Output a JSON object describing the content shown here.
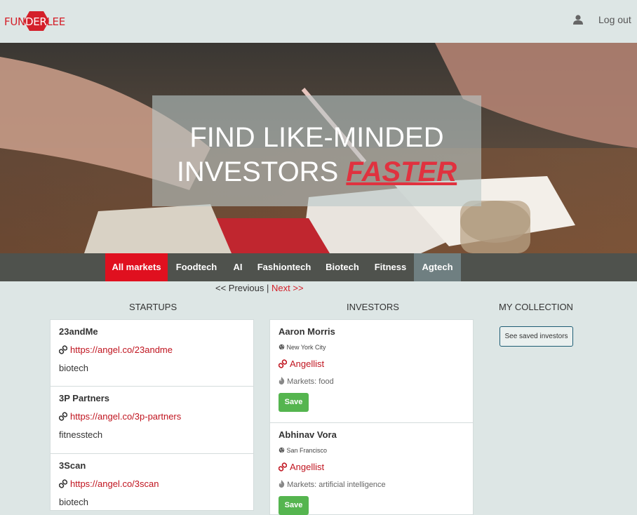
{
  "brand": {
    "logo_left": "FUN",
    "logo_mid": "DER",
    "logo_right": "LEE",
    "accent": "#d4202a"
  },
  "header": {
    "user_icon": "user-icon",
    "logout_label": "Log out"
  },
  "hero": {
    "line1": "FIND LIKE-MINDED",
    "line2_prefix": "INVESTORS",
    "line2_emphasis": "FASTER"
  },
  "nav": {
    "items": [
      {
        "label": "All markets",
        "state": "active"
      },
      {
        "label": "Foodtech",
        "state": "normal"
      },
      {
        "label": "AI",
        "state": "normal"
      },
      {
        "label": "Fashiontech",
        "state": "normal"
      },
      {
        "label": "Biotech",
        "state": "normal"
      },
      {
        "label": "Fitness",
        "state": "normal"
      },
      {
        "label": "Agtech",
        "state": "highlighted"
      }
    ]
  },
  "pager": {
    "prev_label": "<< Previous",
    "separator": "|",
    "next_label": "Next >>"
  },
  "columns": {
    "startups_title": "STARTUPS",
    "investors_title": "INVESTORS",
    "collection_title": "MY COLLECTION"
  },
  "startups": [
    {
      "name": "23andMe",
      "url": "https://angel.co/23andme",
      "market": "biotech"
    },
    {
      "name": "3P Partners",
      "url": "https://angel.co/3p-partners",
      "market": "fitnesstech"
    },
    {
      "name": "3Scan",
      "url": "https://angel.co/3scan",
      "market": "biotech"
    }
  ],
  "investors": [
    {
      "name": "Aaron Morris",
      "location": "New York City",
      "link_label": "Angellist",
      "markets": "Markets: food",
      "save_label": "Save"
    },
    {
      "name": "Abhinav Vora",
      "location": "San Francisco",
      "link_label": "Angellist",
      "markets": "Markets: artificial intelligence",
      "save_label": "Save"
    }
  ],
  "collection": {
    "button_label": "See saved investors"
  }
}
